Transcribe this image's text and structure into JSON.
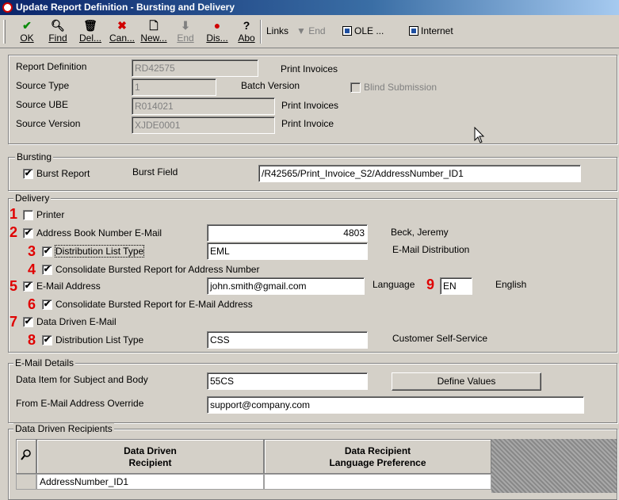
{
  "window": {
    "title": "Update Report Definition - Bursting and Delivery"
  },
  "toolbar": {
    "ok": "OK",
    "find": "Find",
    "delete": "Del...",
    "cancel": "Can...",
    "new": "New...",
    "end": "End",
    "display": "Dis...",
    "about": "Abo",
    "links": "Links",
    "links_end": "End",
    "ole": "OLE ...",
    "internet": "Internet"
  },
  "header": {
    "report_definition_label": "Report Definition",
    "report_definition_value": "RD42575",
    "report_definition_desc": "Print Invoices",
    "source_type_label": "Source Type",
    "source_type_value": "1",
    "batch_version_label": "Batch Version",
    "blind_submission_label": "Blind Submission",
    "source_ube_label": "Source UBE",
    "source_ube_value": "R014021",
    "source_ube_desc": "Print Invoices",
    "source_version_label": "Source Version",
    "source_version_value": "XJDE0001",
    "source_version_desc": "Print Invoice"
  },
  "bursting": {
    "title": "Bursting",
    "burst_report_label": "Burst Report",
    "burst_field_label": "Burst Field",
    "burst_field_value": "/R42565/Print_Invoice_S2/AddressNumber_ID1"
  },
  "delivery": {
    "title": "Delivery",
    "markers": [
      "1",
      "2",
      "3",
      "4",
      "5",
      "6",
      "7",
      "8",
      "9"
    ],
    "printer_label": "Printer",
    "ab_email_label": "Address Book Number E-Mail",
    "ab_email_value": "4803",
    "ab_email_name": "Beck, Jeremy",
    "dist_list_label": "Distribution List Type",
    "dist_list_value": "EML",
    "dist_list_desc": "E-Mail Distribution",
    "consolidate_ab_label": "Consolidate Bursted Report for Address Number",
    "email_address_label": "E-Mail Address",
    "email_address_value": "john.smith@gmail.com",
    "language_label": "Language",
    "language_value": "EN",
    "language_desc": "English",
    "consolidate_email_label": "Consolidate Bursted Report for E-Mail Address",
    "data_driven_label": "Data Driven E-Mail",
    "dd_dist_list_label": "Distribution List Type",
    "dd_dist_list_value": "CSS",
    "dd_dist_list_desc": "Customer Self-Service"
  },
  "email_details": {
    "title": "E-Mail Details",
    "data_item_label": "Data Item for Subject and Body",
    "data_item_value": "55CS",
    "define_values_button": "Define Values",
    "from_override_label": "From E-Mail Address Override",
    "from_override_value": "support@company.com"
  },
  "recipients": {
    "title": "Data Driven Recipients",
    "col1_line1": "Data Driven",
    "col1_line2": "Recipient",
    "col2_line1": "Data Recipient",
    "col2_line2": "Language Preference",
    "rows": [
      {
        "recipient": "AddressNumber_ID1",
        "language": ""
      }
    ]
  }
}
